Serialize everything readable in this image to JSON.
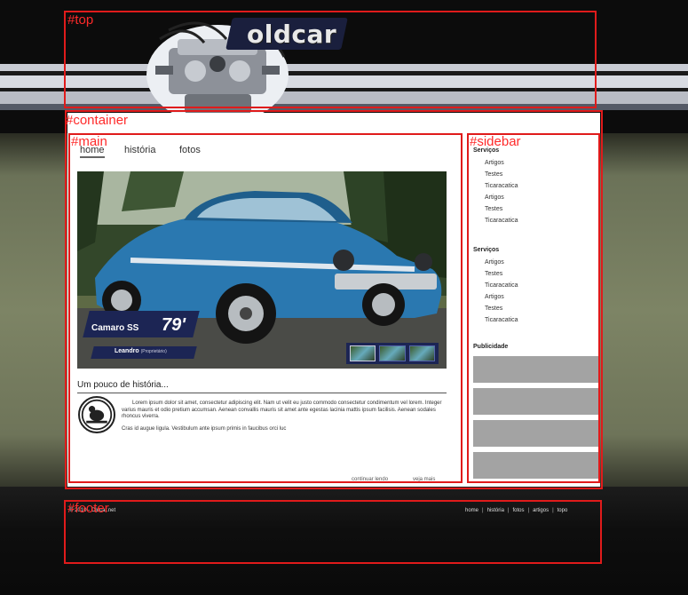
{
  "site": {
    "logo": "oldcar"
  },
  "annotations": {
    "top": "#top",
    "container": "#container",
    "main": "#main",
    "sidebar": "#sidebar",
    "footer": "#footer"
  },
  "nav": {
    "items": [
      {
        "label": "home",
        "active": true
      },
      {
        "label": "história",
        "active": false
      },
      {
        "label": "fotos",
        "active": false
      }
    ]
  },
  "hero": {
    "model": "Camaro SS",
    "year": "79'",
    "owner": "Leandro",
    "owner_role": "(Proprietário)",
    "thumbnail_count": 3
  },
  "history": {
    "title": "Um pouco de história...",
    "paragraph1": "Lorem ipsum dolor sit amet, consectetur adipiscing elit. Nam ut velit eu justo commodo consectetur condimentum vel lorem. Integer varius mauris et odio pretium accumsan. Aenean convallis mauris sit amet ante egestas lacinia mattis ipsum facilisis. Aenean sodales rhoncus viverra.",
    "paragraph2": "Cras id augue ligula. Vestibulum ante ipsum primis in faucibus orci luc",
    "link_continue": "continuar lendo",
    "link_more": "veja mais"
  },
  "sidebar": {
    "sections": [
      {
        "heading": "Serviços",
        "items": [
          "Artigos",
          "Testes",
          "Ticaracatica",
          "Artigos",
          "Testes",
          "Ticaracatica"
        ]
      },
      {
        "heading": "Serviços",
        "items": [
          "Artigos",
          "Testes",
          "Ticaracatica",
          "Artigos",
          "Testes",
          "Ticaracatica"
        ]
      }
    ],
    "ads_heading": "Publicidade",
    "ad_count": 4
  },
  "footer": {
    "copyright": "© 2010 - Oldcar.net",
    "links": [
      "home",
      "história",
      "fotos",
      "artigos",
      "topo"
    ]
  },
  "colors": {
    "annotation_red": "#e01b1b",
    "navy_label": "#1c2554",
    "car_blue": "#2a78b0",
    "ad_gray": "#a3a3a3"
  }
}
